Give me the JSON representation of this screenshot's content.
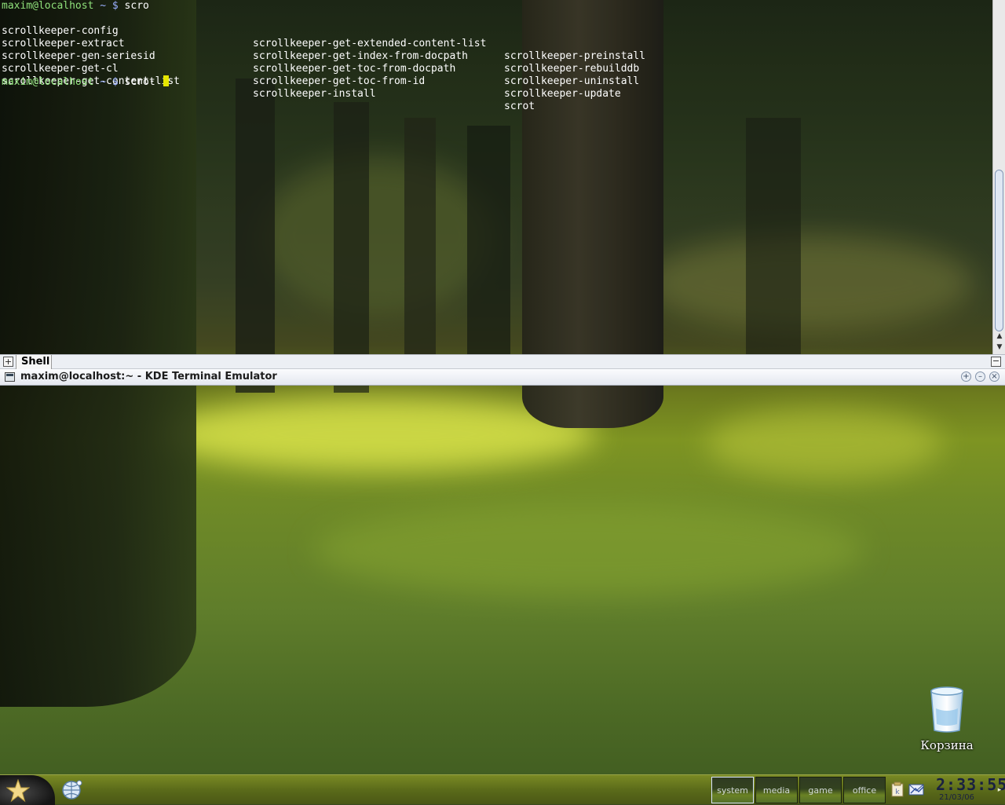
{
  "terminal": {
    "prompt_user": "maxim@localhost",
    "prompt_path": " ~ $",
    "command1": " scro",
    "completions": [
      [
        "scrollkeeper-config",
        "scrollkeeper-get-extended-content-list",
        "scrollkeeper-preinstall"
      ],
      [
        "scrollkeeper-extract",
        "scrollkeeper-get-index-from-docpath",
        "scrollkeeper-rebuilddb"
      ],
      [
        "scrollkeeper-gen-seriesid",
        "scrollkeeper-get-toc-from-docpath",
        "scrollkeeper-uninstall"
      ],
      [
        "scrollkeeper-get-cl",
        "scrollkeeper-get-toc-from-id",
        "scrollkeeper-update"
      ],
      [
        "scrollkeeper-get-content-list",
        "scrollkeeper-install",
        "scrot"
      ]
    ],
    "command2": " scrot ",
    "tab_label": "Shell",
    "new_tab_glyph": "+",
    "close_tab_glyph": "−",
    "scroll_up": "▲",
    "scroll_down": "▼"
  },
  "window": {
    "title": "maxim@localhost:~ - KDE Terminal Emulator",
    "btn_sticky": "+",
    "btn_minimize": "–",
    "btn_close": "×"
  },
  "desktop": {
    "trash_label": "Корзина"
  },
  "panel": {
    "desktops": [
      {
        "label": "system",
        "active": true
      },
      {
        "label": "media",
        "active": false
      },
      {
        "label": "game",
        "active": false
      },
      {
        "label": "office",
        "active": false
      }
    ],
    "clock_time": "2:33:55",
    "clock_date": "21/03/06",
    "handle": "▸"
  }
}
